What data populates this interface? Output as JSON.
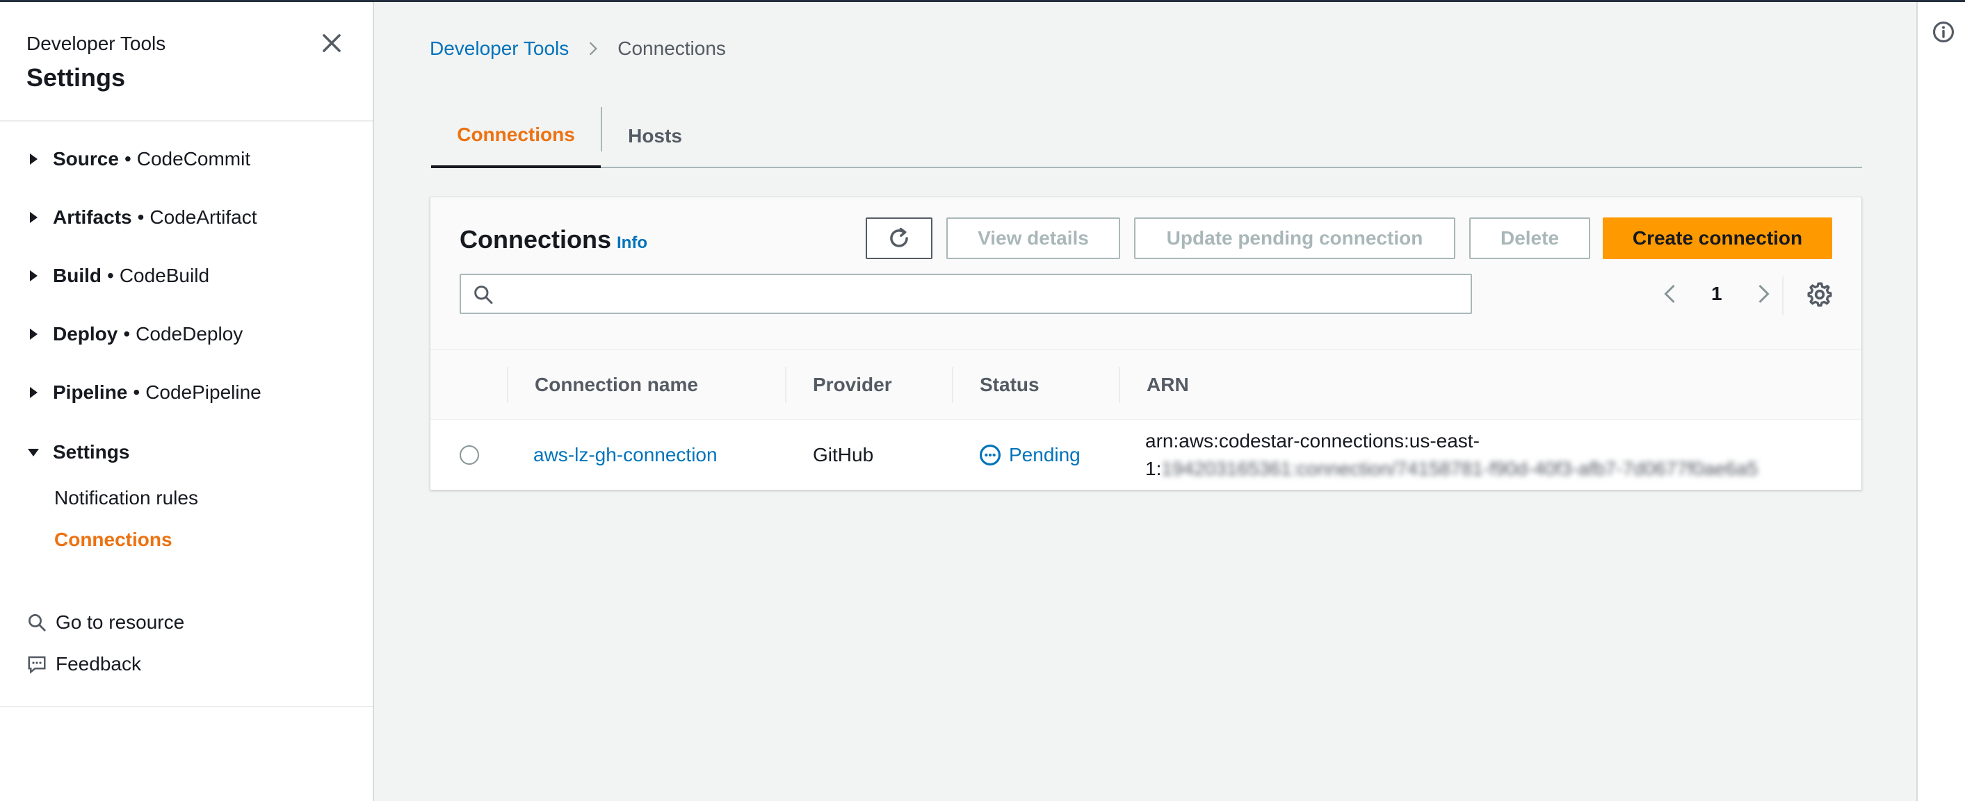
{
  "sidebar": {
    "subtitle": "Developer Tools",
    "title": "Settings",
    "sections": [
      {
        "label": "Source",
        "service": "CodeCommit"
      },
      {
        "label": "Artifacts",
        "service": "CodeArtifact"
      },
      {
        "label": "Build",
        "service": "CodeBuild"
      },
      {
        "label": "Deploy",
        "service": "CodeDeploy"
      },
      {
        "label": "Pipeline",
        "service": "CodePipeline"
      }
    ],
    "settings_label": "Settings",
    "settings_items": [
      "Notification rules",
      "Connections"
    ],
    "go_to_resource": "Go to resource",
    "feedback": "Feedback"
  },
  "breadcrumb": {
    "root": "Developer Tools",
    "current": "Connections"
  },
  "tabs": [
    "Connections",
    "Hosts"
  ],
  "panel": {
    "title": "Connections",
    "info": "Info",
    "buttons": {
      "view": "View details",
      "update": "Update pending connection",
      "delete": "Delete",
      "create": "Create connection"
    },
    "search_placeholder": "",
    "page": "1"
  },
  "table": {
    "columns": [
      "Connection name",
      "Provider",
      "Status",
      "ARN"
    ],
    "rows": [
      {
        "name": "aws-lz-gh-connection",
        "provider": "GitHub",
        "status": "Pending",
        "arn_line1": "arn:aws:codestar-connections:us-east-",
        "arn_line2_prefix": "1:",
        "arn_line2_redacted": "194203165361:connection/74158781-f90d-40f3-afb7-7d0677f0ae6a5"
      }
    ]
  },
  "colors": {
    "accent": "#ec7211",
    "link": "#0073bb",
    "primary_button": "#ff9900"
  }
}
